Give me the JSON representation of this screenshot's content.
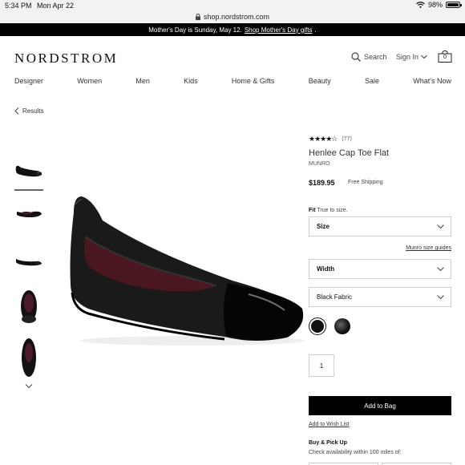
{
  "status_bar": {
    "time": "5:34 PM",
    "date": "Mon Apr 22",
    "battery": "98%",
    "battery_level": 0.98
  },
  "url_bar": {
    "url": "shop.nordstrom.com"
  },
  "promo": {
    "text": "Mother's Day is Sunday, May 12.",
    "link": "Shop Mother's Day gifts",
    "suffix": "."
  },
  "header": {
    "logo": "NORDSTROM",
    "search_label": "Search",
    "signin_label": "Sign In",
    "bag_count": "0"
  },
  "nav": {
    "items": [
      "Designer",
      "Women",
      "Men",
      "Kids",
      "Home & Gifts",
      "Beauty",
      "Sale",
      "What's Now"
    ]
  },
  "breadcrumb": {
    "back_label": "Results"
  },
  "product": {
    "rating_stars": "★★★★☆",
    "rating_value": 4.5,
    "review_count": "(77)",
    "title": "Henlee Cap Toe Flat",
    "brand": "MUNRO",
    "price": "$189.95",
    "shipping": "Free Shipping",
    "fit_label": "Fit",
    "fit_value": "True to size.",
    "size_label": "Size",
    "size_guide_link": "Munro size guides",
    "width_label": "Width",
    "color_value": "Black Fabric",
    "quantity": "1",
    "add_to_bag": "Add to Bag",
    "wishlist": "Add to Wish List",
    "pickup_title": "Buy & Pick Up",
    "pickup_text": "Check availability within 100 miles of:"
  },
  "colors": {
    "promo_bg": "#000000",
    "button_bg": "#000000",
    "border": "#cfcfcf"
  }
}
